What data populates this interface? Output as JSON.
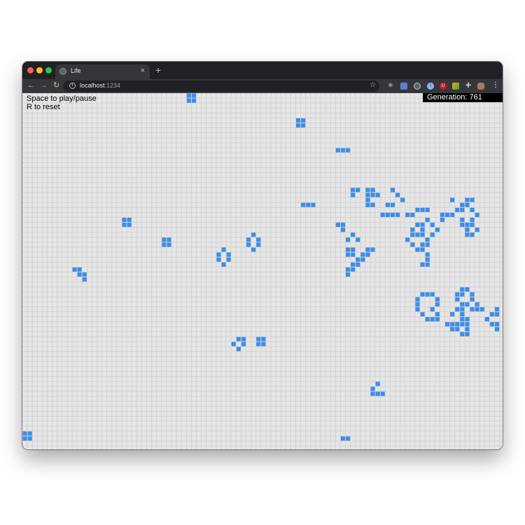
{
  "browser": {
    "tab_title": "Life",
    "tab_close": "×",
    "new_tab": "+",
    "url_host": "localhost",
    "url_port": ":1234",
    "icons": [
      "back-arrow-icon",
      "forward-arrow-icon",
      "reload-icon",
      "info-icon",
      "star-icon",
      "menu-dots-icon"
    ]
  },
  "page": {
    "help_line1": "Space to play/pause",
    "help_line2": "R to reset",
    "generation_label": "Generation: 761"
  },
  "colors": {
    "live_cell": "#3b8eea",
    "dead_cell": "#e6e6e6",
    "grid_line": "#d3d3d3"
  },
  "live_cells": [
    [
      33,
      0
    ],
    [
      34,
      0
    ],
    [
      33,
      1
    ],
    [
      34,
      1
    ],
    [
      55,
      5
    ],
    [
      56,
      5
    ],
    [
      55,
      6
    ],
    [
      56,
      6
    ],
    [
      63,
      11
    ],
    [
      64,
      11
    ],
    [
      65,
      11
    ],
    [
      66,
      19
    ],
    [
      67,
      19
    ],
    [
      69,
      19
    ],
    [
      70,
      19
    ],
    [
      74,
      19
    ],
    [
      66,
      20
    ],
    [
      69,
      20
    ],
    [
      70,
      20
    ],
    [
      71,
      20
    ],
    [
      75,
      20
    ],
    [
      69,
      21
    ],
    [
      76,
      21
    ],
    [
      86,
      21
    ],
    [
      89,
      21
    ],
    [
      90,
      21
    ],
    [
      56,
      22
    ],
    [
      57,
      22
    ],
    [
      58,
      22
    ],
    [
      69,
      22
    ],
    [
      70,
      22
    ],
    [
      73,
      22
    ],
    [
      74,
      22
    ],
    [
      88,
      22
    ],
    [
      89,
      22
    ],
    [
      79,
      23
    ],
    [
      80,
      23
    ],
    [
      81,
      23
    ],
    [
      87,
      23
    ],
    [
      88,
      23
    ],
    [
      90,
      23
    ],
    [
      72,
      24
    ],
    [
      73,
      24
    ],
    [
      74,
      24
    ],
    [
      75,
      24
    ],
    [
      77,
      24
    ],
    [
      78,
      24
    ],
    [
      84,
      24
    ],
    [
      85,
      24
    ],
    [
      86,
      24
    ],
    [
      91,
      24
    ],
    [
      20,
      25
    ],
    [
      21,
      25
    ],
    [
      81,
      25
    ],
    [
      84,
      25
    ],
    [
      88,
      25
    ],
    [
      90,
      25
    ],
    [
      20,
      26
    ],
    [
      21,
      26
    ],
    [
      63,
      26
    ],
    [
      64,
      26
    ],
    [
      79,
      26
    ],
    [
      80,
      26
    ],
    [
      82,
      26
    ],
    [
      88,
      26
    ],
    [
      89,
      26
    ],
    [
      90,
      26
    ],
    [
      64,
      27
    ],
    [
      78,
      27
    ],
    [
      80,
      27
    ],
    [
      83,
      27
    ],
    [
      89,
      27
    ],
    [
      91,
      27
    ],
    [
      46,
      28
    ],
    [
      66,
      28
    ],
    [
      78,
      28
    ],
    [
      79,
      28
    ],
    [
      80,
      28
    ],
    [
      82,
      28
    ],
    [
      89,
      28
    ],
    [
      90,
      28
    ],
    [
      28,
      29
    ],
    [
      29,
      29
    ],
    [
      45,
      29
    ],
    [
      47,
      29
    ],
    [
      65,
      29
    ],
    [
      67,
      29
    ],
    [
      77,
      29
    ],
    [
      81,
      29
    ],
    [
      28,
      30
    ],
    [
      29,
      30
    ],
    [
      45,
      30
    ],
    [
      47,
      30
    ],
    [
      78,
      30
    ],
    [
      80,
      30
    ],
    [
      81,
      30
    ],
    [
      40,
      31
    ],
    [
      46,
      31
    ],
    [
      65,
      31
    ],
    [
      66,
      31
    ],
    [
      69,
      31
    ],
    [
      70,
      31
    ],
    [
      79,
      31
    ],
    [
      80,
      31
    ],
    [
      39,
      32
    ],
    [
      41,
      32
    ],
    [
      65,
      32
    ],
    [
      66,
      32
    ],
    [
      68,
      32
    ],
    [
      69,
      32
    ],
    [
      81,
      32
    ],
    [
      39,
      33
    ],
    [
      41,
      33
    ],
    [
      67,
      33
    ],
    [
      68,
      33
    ],
    [
      81,
      33
    ],
    [
      40,
      34
    ],
    [
      66,
      34
    ],
    [
      67,
      34
    ],
    [
      80,
      34
    ],
    [
      81,
      34
    ],
    [
      10,
      35
    ],
    [
      11,
      35
    ],
    [
      65,
      35
    ],
    [
      66,
      35
    ],
    [
      11,
      36
    ],
    [
      12,
      36
    ],
    [
      65,
      36
    ],
    [
      12,
      37
    ],
    [
      88,
      39
    ],
    [
      89,
      39
    ],
    [
      80,
      40
    ],
    [
      81,
      40
    ],
    [
      82,
      40
    ],
    [
      87,
      40
    ],
    [
      88,
      40
    ],
    [
      90,
      40
    ],
    [
      79,
      41
    ],
    [
      83,
      41
    ],
    [
      87,
      41
    ],
    [
      90,
      41
    ],
    [
      79,
      42
    ],
    [
      83,
      42
    ],
    [
      88,
      42
    ],
    [
      89,
      42
    ],
    [
      91,
      42
    ],
    [
      79,
      43
    ],
    [
      82,
      43
    ],
    [
      87,
      43
    ],
    [
      88,
      43
    ],
    [
      90,
      43
    ],
    [
      91,
      43
    ],
    [
      92,
      43
    ],
    [
      95,
      43
    ],
    [
      80,
      44
    ],
    [
      83,
      44
    ],
    [
      86,
      44
    ],
    [
      88,
      44
    ],
    [
      94,
      44
    ],
    [
      95,
      44
    ],
    [
      81,
      45
    ],
    [
      82,
      45
    ],
    [
      83,
      45
    ],
    [
      88,
      45
    ],
    [
      89,
      45
    ],
    [
      93,
      45
    ],
    [
      85,
      46
    ],
    [
      86,
      46
    ],
    [
      87,
      46
    ],
    [
      88,
      46
    ],
    [
      89,
      46
    ],
    [
      94,
      46
    ],
    [
      95,
      46
    ],
    [
      86,
      47
    ],
    [
      87,
      47
    ],
    [
      89,
      47
    ],
    [
      95,
      47
    ],
    [
      88,
      48
    ],
    [
      89,
      48
    ],
    [
      43,
      49
    ],
    [
      44,
      49
    ],
    [
      47,
      49
    ],
    [
      48,
      49
    ],
    [
      42,
      50
    ],
    [
      44,
      50
    ],
    [
      47,
      50
    ],
    [
      48,
      50
    ],
    [
      43,
      51
    ],
    [
      71,
      58
    ],
    [
      70,
      59
    ],
    [
      70,
      60
    ],
    [
      71,
      60
    ],
    [
      72,
      60
    ],
    [
      0,
      68
    ],
    [
      1,
      68
    ],
    [
      0,
      69
    ],
    [
      1,
      69
    ],
    [
      64,
      69
    ],
    [
      65,
      69
    ]
  ]
}
